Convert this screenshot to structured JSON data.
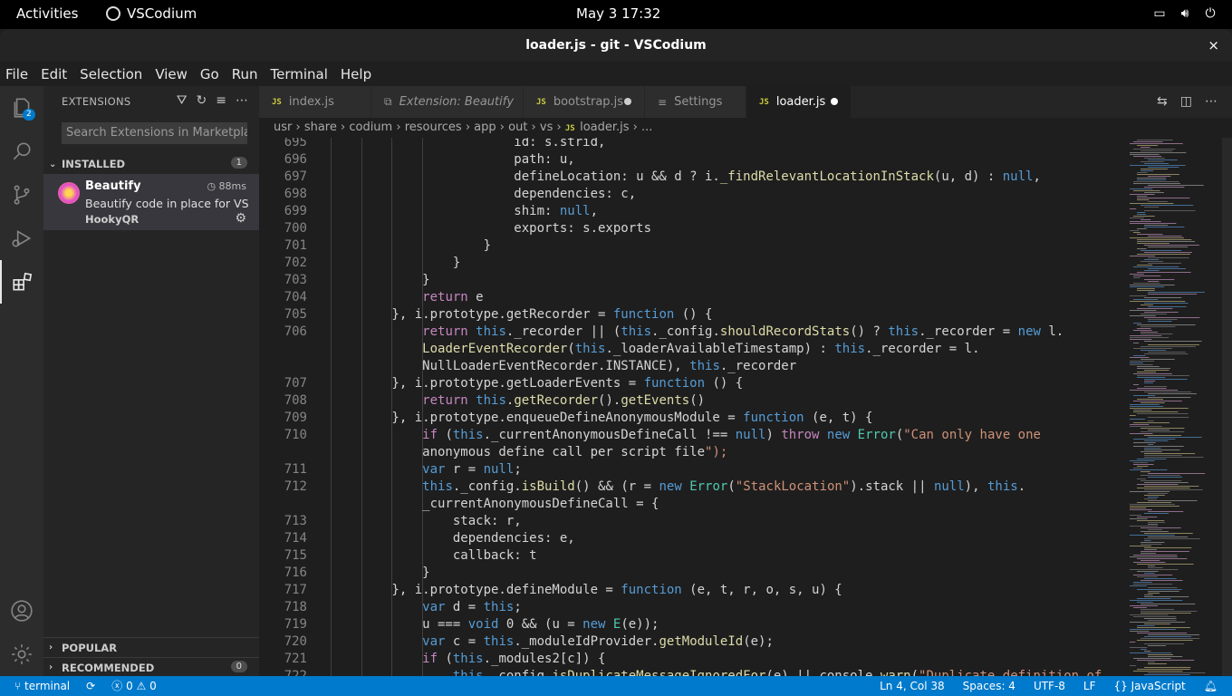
{
  "topbar": {
    "activities": "Activities",
    "app_name": "VSCodium",
    "clock": "May 3  17:32"
  },
  "window": {
    "title": "loader.js - git - VSCodium",
    "close": "×"
  },
  "menu": [
    "File",
    "Edit",
    "Selection",
    "View",
    "Go",
    "Run",
    "Terminal",
    "Help"
  ],
  "activity": {
    "explorer_badge": "2"
  },
  "sidebar": {
    "title": "EXTENSIONS",
    "search_placeholder": "Search Extensions in Marketplace",
    "installed": {
      "label": "INSTALLED",
      "count": "1"
    },
    "extension": {
      "name": "Beautify",
      "time": "88ms",
      "description": "Beautify code in place for VS Code",
      "publisher": "HookyQR"
    },
    "popular": {
      "label": "POPULAR"
    },
    "recommended": {
      "label": "RECOMMENDED",
      "count": "0"
    }
  },
  "tabs": [
    {
      "icon": "JS",
      "label": "index.js",
      "italic": false,
      "dirty": false,
      "active": false
    },
    {
      "icon": "",
      "label": "Extension: Beautify",
      "italic": true,
      "dirty": false,
      "active": false
    },
    {
      "icon": "JS",
      "label": "bootstrap.js",
      "italic": false,
      "dirty": true,
      "active": false
    },
    {
      "icon": "",
      "label": "Settings",
      "italic": false,
      "dirty": false,
      "active": false
    },
    {
      "icon": "JS",
      "label": "loader.js",
      "italic": false,
      "dirty": true,
      "active": true
    }
  ],
  "breadcrumb": [
    "usr",
    "share",
    "codium",
    "resources",
    "app",
    "out",
    "vs",
    "loader.js",
    "..."
  ],
  "code_lines": [
    {
      "n": "695",
      "t": "                        id: s.strid,"
    },
    {
      "n": "696",
      "t": "                        path: u,"
    },
    {
      "n": "697",
      "t": "                        defineLocation: u && d ? i._findRelevantLocationInStack(u, d) : null,"
    },
    {
      "n": "698",
      "t": "                        dependencies: c,"
    },
    {
      "n": "699",
      "t": "                        shim: null,"
    },
    {
      "n": "700",
      "t": "                        exports: s.exports"
    },
    {
      "n": "701",
      "t": "                    }"
    },
    {
      "n": "702",
      "t": "                }"
    },
    {
      "n": "703",
      "t": "            }"
    },
    {
      "n": "704",
      "t": "            return e"
    },
    {
      "n": "705",
      "t": "        }, i.prototype.getRecorder = function () {"
    },
    {
      "n": "706",
      "t": "            return this._recorder || (this._config.shouldRecordStats() ? this._recorder = new l."
    },
    {
      "n": "",
      "t": "            LoaderEventRecorder(this._loaderAvailableTimestamp) : this._recorder = l."
    },
    {
      "n": "",
      "t": "            NullLoaderEventRecorder.INSTANCE), this._recorder"
    },
    {
      "n": "707",
      "t": "        }, i.prototype.getLoaderEvents = function () {"
    },
    {
      "n": "708",
      "t": "            return this.getRecorder().getEvents()"
    },
    {
      "n": "709",
      "t": "        }, i.prototype.enqueueDefineAnonymousModule = function (e, t) {"
    },
    {
      "n": "710",
      "t": "            if (this._currentAnonymousDefineCall !== null) throw new Error(\"Can only have one"
    },
    {
      "n": "",
      "t": "            anonymous define call per script file\");"
    },
    {
      "n": "711",
      "t": "            var r = null;"
    },
    {
      "n": "712",
      "t": "            this._config.isBuild() && (r = new Error(\"StackLocation\").stack || null), this."
    },
    {
      "n": "",
      "t": "            _currentAnonymousDefineCall = {"
    },
    {
      "n": "713",
      "t": "                stack: r,"
    },
    {
      "n": "714",
      "t": "                dependencies: e,"
    },
    {
      "n": "715",
      "t": "                callback: t"
    },
    {
      "n": "716",
      "t": "            }"
    },
    {
      "n": "717",
      "t": "        }, i.prototype.defineModule = function (e, t, r, o, s, u) {"
    },
    {
      "n": "718",
      "t": "            var d = this;"
    },
    {
      "n": "719",
      "t": "            u === void 0 && (u = new E(e));"
    },
    {
      "n": "720",
      "t": "            var c = this._moduleIdProvider.getModuleId(e);"
    },
    {
      "n": "721",
      "t": "            if (this._modules2[c]) {"
    },
    {
      "n": "722",
      "t": "                this._config.isDuplicateMessageIgnoredFor(e) || console.warn(\"Duplicate definition of"
    }
  ],
  "statusbar": {
    "branch": "terminal",
    "sync": "⟳",
    "errors": "0",
    "warnings": "0",
    "position": "Ln 4, Col 38",
    "spaces": "Spaces: 4",
    "encoding": "UTF-8",
    "eol": "LF",
    "language": "JavaScript"
  },
  "colors": {
    "accent": "#007acc",
    "keyword": "#569cd6",
    "control": "#c586c0",
    "function": "#dcdcaa",
    "string": "#ce9178",
    "js_icon": "#cbcb41"
  }
}
